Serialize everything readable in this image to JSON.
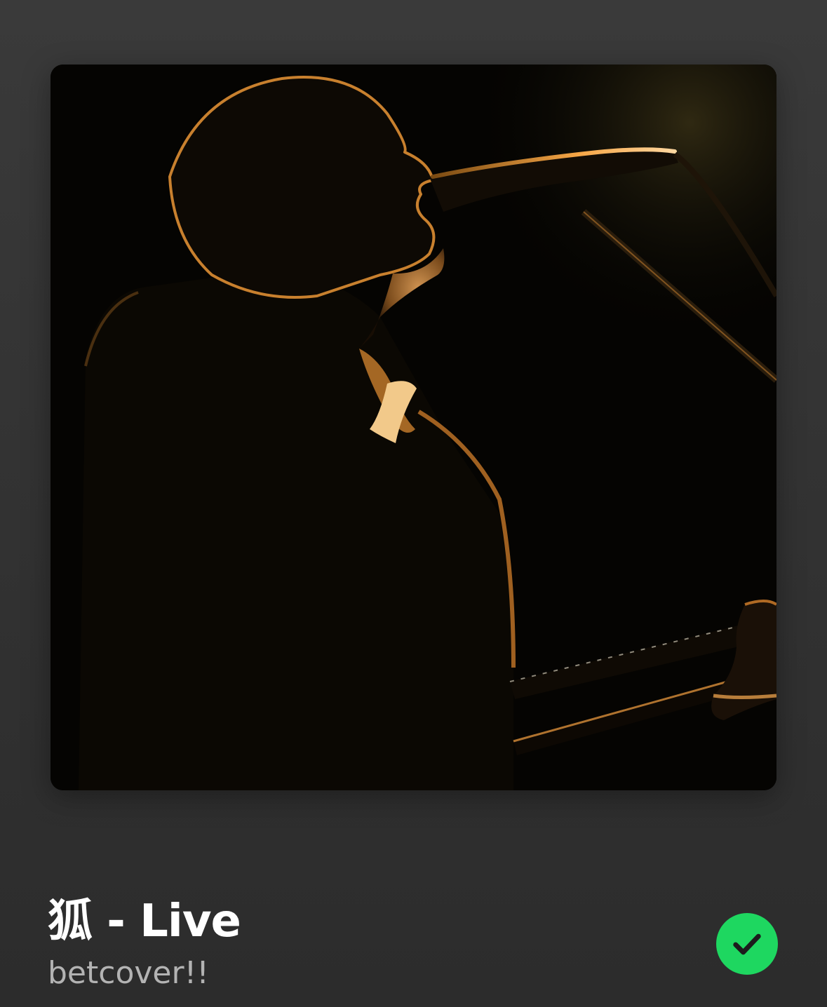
{
  "now_playing": {
    "title": "狐 - Live",
    "artist": "betcover!!",
    "saved": true
  },
  "icons": {
    "saved": "check-circle-icon"
  },
  "colors": {
    "background_top": "#3a3a3a",
    "background_bottom": "#2c2c2c",
    "title": "#ffffff",
    "artist": "#b3b3b3",
    "accent": "#1ed760",
    "check": "#1c1c1c",
    "rim_light": "#f0a040"
  }
}
